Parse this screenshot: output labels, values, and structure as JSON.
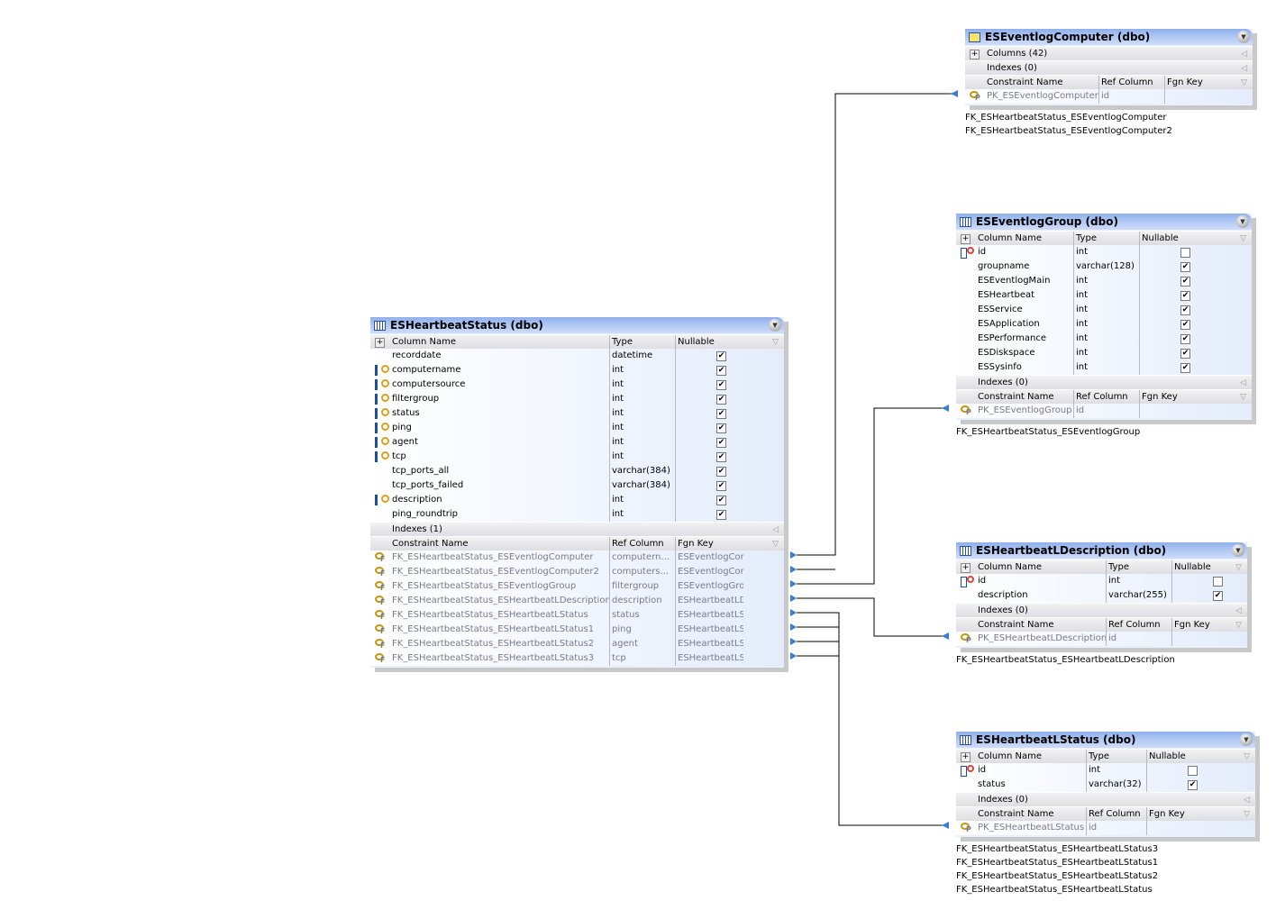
{
  "colors": {
    "header": "#b8cdf5",
    "line": "#000000",
    "arrow": "#3a7ad8"
  },
  "tables": [
    {
      "title": "ESHeartbeatStatus (dbo)",
      "icon": "table-icon",
      "columns_header": [
        "Column Name",
        "Type",
        "Nullable"
      ],
      "columns": [
        {
          "name": "recorddate",
          "type": "datetime",
          "nullable": true,
          "key": ""
        },
        {
          "name": "computername",
          "type": "int",
          "nullable": true,
          "key": "fk"
        },
        {
          "name": "computersource",
          "type": "int",
          "nullable": true,
          "key": "fk"
        },
        {
          "name": "filtergroup",
          "type": "int",
          "nullable": true,
          "key": "fk"
        },
        {
          "name": "status",
          "type": "int",
          "nullable": true,
          "key": "fk"
        },
        {
          "name": "ping",
          "type": "int",
          "nullable": true,
          "key": "fk"
        },
        {
          "name": "agent",
          "type": "int",
          "nullable": true,
          "key": "fk"
        },
        {
          "name": "tcp",
          "type": "int",
          "nullable": true,
          "key": "fk"
        },
        {
          "name": "tcp_ports_all",
          "type": "varchar(384)",
          "nullable": true,
          "key": ""
        },
        {
          "name": "tcp_ports_failed",
          "type": "varchar(384)",
          "nullable": true,
          "key": ""
        },
        {
          "name": "description",
          "type": "int",
          "nullable": true,
          "key": "fk"
        },
        {
          "name": "ping_roundtrip",
          "type": "int",
          "nullable": true,
          "key": ""
        }
      ],
      "indexes": "Indexes (1)",
      "constraints_header": [
        "Constraint Name",
        "Ref Column",
        "Fgn Key"
      ],
      "constraints": [
        {
          "name": "FK_ESHeartbeatStatus_ESEventlogComputer",
          "ref": "computern...",
          "fgn": "ESEventlogComp...",
          "kind": "f"
        },
        {
          "name": "FK_ESHeartbeatStatus_ESEventlogComputer2",
          "ref": "computers...",
          "fgn": "ESEventlogComp...",
          "kind": "f"
        },
        {
          "name": "FK_ESHeartbeatStatus_ESEventlogGroup",
          "ref": "filtergroup",
          "fgn": "ESEventlogGroup...",
          "kind": "f"
        },
        {
          "name": "FK_ESHeartbeatStatus_ESHeartbeatLDescription",
          "ref": "description",
          "fgn": "ESHeartbeatLDes...",
          "kind": "f"
        },
        {
          "name": "FK_ESHeartbeatStatus_ESHeartbeatLStatus",
          "ref": "status",
          "fgn": "ESHeartbeatLSta...",
          "kind": "f"
        },
        {
          "name": "FK_ESHeartbeatStatus_ESHeartbeatLStatus1",
          "ref": "ping",
          "fgn": "ESHeartbeatLSta...",
          "kind": "f"
        },
        {
          "name": "FK_ESHeartbeatStatus_ESHeartbeatLStatus2",
          "ref": "agent",
          "fgn": "ESHeartbeatLSta...",
          "kind": "f"
        },
        {
          "name": "FK_ESHeartbeatStatus_ESHeartbeatLStatus3",
          "ref": "tcp",
          "fgn": "ESHeartbeatLSta...",
          "kind": "f"
        }
      ],
      "labels": []
    },
    {
      "title": "ESEventlogComputer (dbo)",
      "icon": "view-icon",
      "columns_summary": "Columns (42)",
      "indexes": "Indexes (0)",
      "constraints_header": [
        "Constraint Name",
        "Ref Column",
        "Fgn Key"
      ],
      "constraints": [
        {
          "name": "PK_ESEventlogComputer",
          "ref": "id",
          "fgn": "",
          "kind": "p"
        }
      ],
      "labels": [
        "FK_ESHeartbeatStatus_ESEventlogComputer",
        "FK_ESHeartbeatStatus_ESEventlogComputer2"
      ]
    },
    {
      "title": "ESEventlogGroup (dbo)",
      "icon": "table-icon",
      "columns_header": [
        "Column Name",
        "Type",
        "Nullable"
      ],
      "columns": [
        {
          "name": "id",
          "type": "int",
          "nullable": false,
          "key": "pk"
        },
        {
          "name": "groupname",
          "type": "varchar(128)",
          "nullable": true,
          "key": ""
        },
        {
          "name": "ESEventlogMain",
          "type": "int",
          "nullable": true,
          "key": ""
        },
        {
          "name": "ESHeartbeat",
          "type": "int",
          "nullable": true,
          "key": ""
        },
        {
          "name": "ESService",
          "type": "int",
          "nullable": true,
          "key": ""
        },
        {
          "name": "ESApplication",
          "type": "int",
          "nullable": true,
          "key": ""
        },
        {
          "name": "ESPerformance",
          "type": "int",
          "nullable": true,
          "key": ""
        },
        {
          "name": "ESDiskspace",
          "type": "int",
          "nullable": true,
          "key": ""
        },
        {
          "name": "ESSysinfo",
          "type": "int",
          "nullable": true,
          "key": ""
        }
      ],
      "indexes": "Indexes (0)",
      "constraints_header": [
        "Constraint Name",
        "Ref Column",
        "Fgn Key"
      ],
      "constraints": [
        {
          "name": "PK_ESEventlogGroup",
          "ref": "id",
          "fgn": "",
          "kind": "p"
        }
      ],
      "labels": [
        "FK_ESHeartbeatStatus_ESEventlogGroup"
      ]
    },
    {
      "title": "ESHeartbeatLDescription (dbo)",
      "icon": "table-icon",
      "columns_header": [
        "Column Name",
        "Type",
        "Nullable"
      ],
      "columns": [
        {
          "name": "id",
          "type": "int",
          "nullable": false,
          "key": "pk"
        },
        {
          "name": "description",
          "type": "varchar(255)",
          "nullable": true,
          "key": ""
        }
      ],
      "indexes": "Indexes (0)",
      "constraints_header": [
        "Constraint Name",
        "Ref Column",
        "Fgn Key"
      ],
      "constraints": [
        {
          "name": "PK_ESHeartbeatLDescription",
          "ref": "id",
          "fgn": "",
          "kind": "p"
        }
      ],
      "labels": [
        "FK_ESHeartbeatStatus_ESHeartbeatLDescription"
      ]
    },
    {
      "title": "ESHeartbeatLStatus (dbo)",
      "icon": "table-icon",
      "columns_header": [
        "Column Name",
        "Type",
        "Nullable"
      ],
      "columns": [
        {
          "name": "id",
          "type": "int",
          "nullable": false,
          "key": "pk"
        },
        {
          "name": "status",
          "type": "varchar(32)",
          "nullable": true,
          "key": ""
        }
      ],
      "indexes": "Indexes (0)",
      "constraints_header": [
        "Constraint Name",
        "Ref Column",
        "Fgn Key"
      ],
      "constraints": [
        {
          "name": "PK_ESHeartbeatLStatus",
          "ref": "id",
          "fgn": "",
          "kind": "p"
        }
      ],
      "labels": [
        "FK_ESHeartbeatStatus_ESHeartbeatLStatus3",
        "FK_ESHeartbeatStatus_ESHeartbeatLStatus1",
        "FK_ESHeartbeatStatus_ESHeartbeatLStatus2",
        "FK_ESHeartbeatStatus_ESHeartbeatLStatus"
      ]
    }
  ]
}
